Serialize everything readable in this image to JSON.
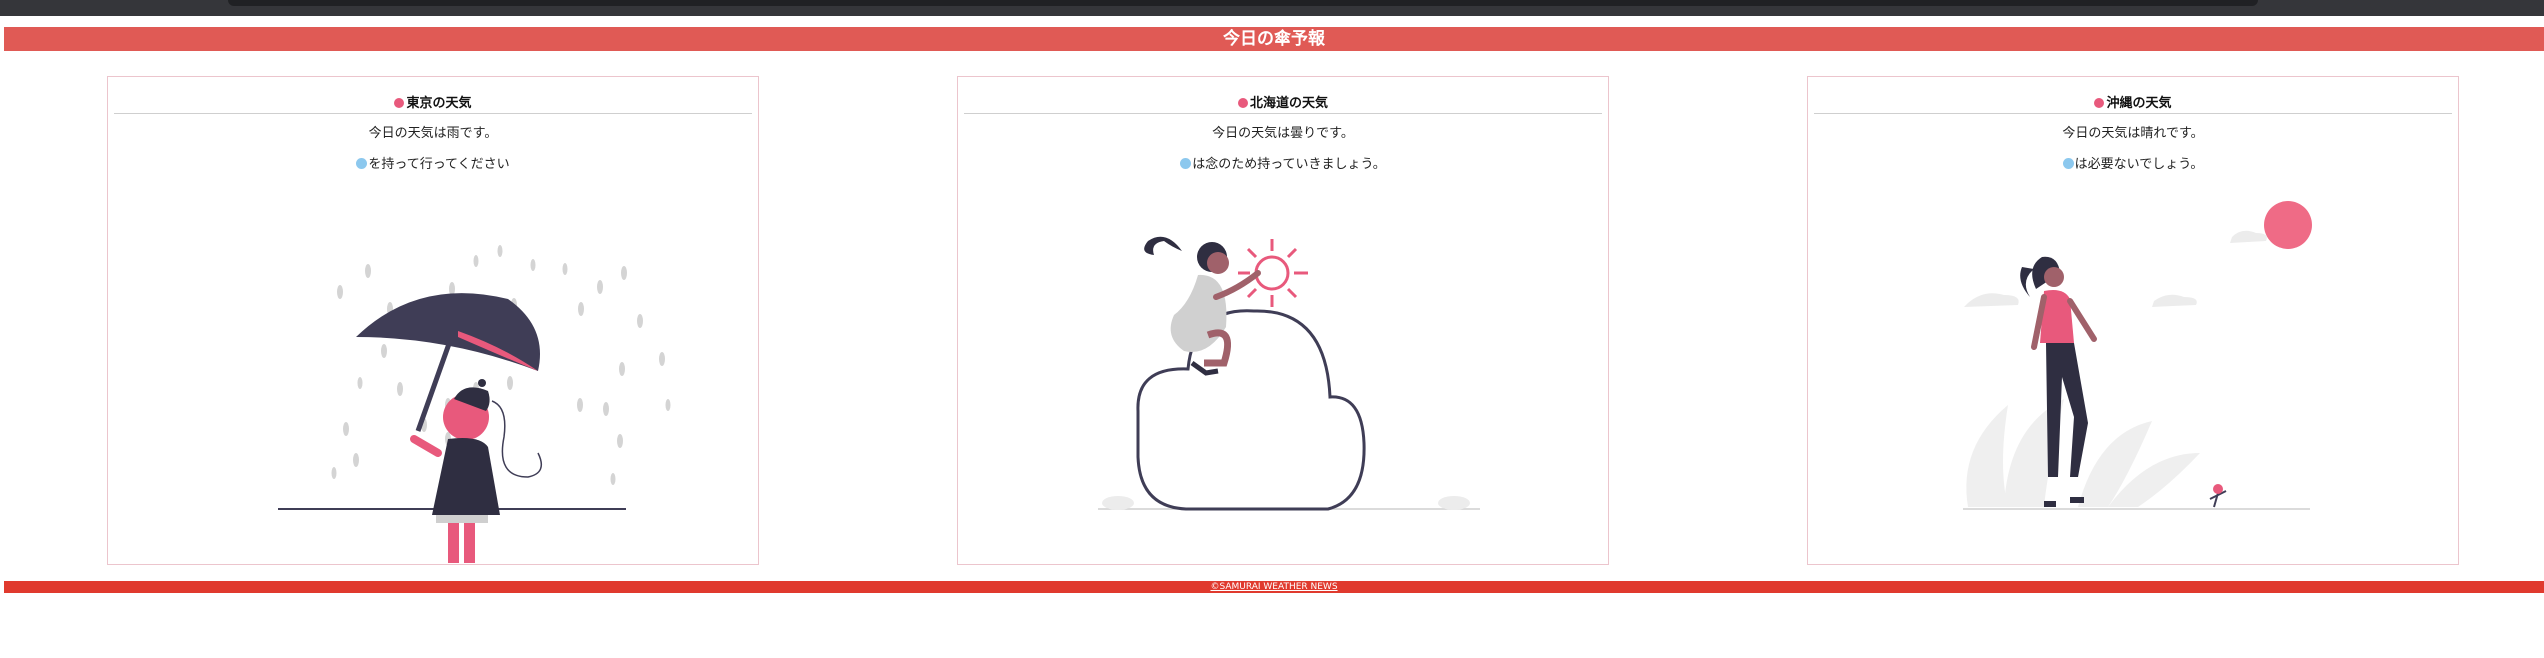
{
  "header": {
    "title": "今日の傘予報"
  },
  "cards": [
    {
      "title": "東京の天気",
      "forecast": "今日の天気は雨です。",
      "advice": "を持って行ってください",
      "illustration": "woman-with-umbrella-in-rain"
    },
    {
      "title": "北海道の天気",
      "forecast": "今日の天気は曇りです。",
      "advice": "は念のため持っていきましょう。",
      "illustration": "woman-sitting-on-cloud-with-sun"
    },
    {
      "title": "沖縄の天気",
      "forecast": "今日の天気は晴れです。",
      "advice": "は必要ないでしょう。",
      "illustration": "woman-walking-in-sunny-weather"
    }
  ],
  "footer": {
    "text": "©SAMURAI WEATHER NEWS"
  },
  "colors": {
    "header": "#e05a55",
    "footer": "#e03a2e",
    "accent_pink": "#e8597c",
    "umbrella_icon": "#8cc8ee",
    "card_border": "#ecc5cd",
    "dark_navy": "#3f3d56"
  },
  "icons": {
    "title_marker": "pink-dot-icon",
    "umbrella_marker": "umbrella-icon"
  }
}
